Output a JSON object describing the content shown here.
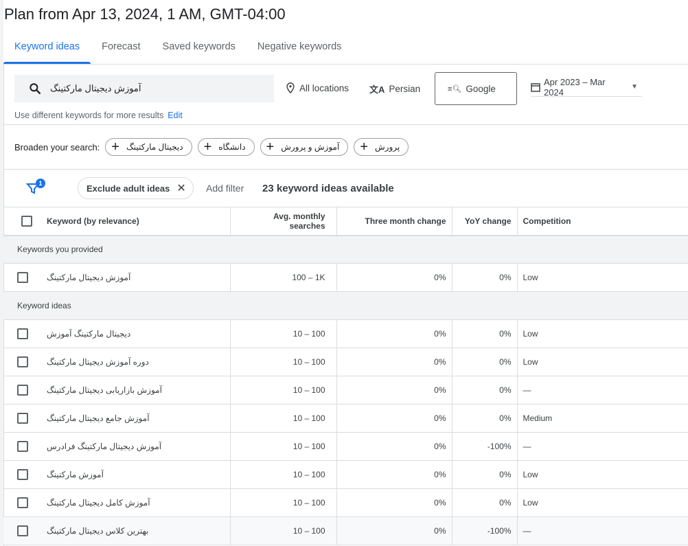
{
  "title": "Plan from Apr 13, 2024, 1 AM, GMT-04:00",
  "tabs": [
    {
      "label": "Keyword ideas"
    },
    {
      "label": "Forecast"
    },
    {
      "label": "Saved keywords"
    },
    {
      "label": "Negative keywords"
    }
  ],
  "search": {
    "value": "آموزش دیجیتال مارکتینگ",
    "location": "All locations",
    "language": "Persian",
    "network": "Google",
    "date_range": "Apr 2023 – Mar 2024",
    "hint": "Use different keywords for more results",
    "edit": "Edit"
  },
  "broaden": {
    "label": "Broaden your search:",
    "chips": [
      "دیجیتال مارکتینگ",
      "دانشگاه",
      "آموزش و پرورش",
      "پرورش"
    ]
  },
  "filters": {
    "badge": "1",
    "exclude": "Exclude adult ideas",
    "add_filter": "Add filter",
    "count": "23 keyword ideas available"
  },
  "table": {
    "headers": [
      "Keyword (by relevance)",
      "Avg. monthly searches",
      "Three month change",
      "YoY change",
      "Competition"
    ],
    "section_provided": "Keywords you provided",
    "provided": [
      {
        "kw": "آموزش دیجیتال مارکتینگ",
        "avg": "100 – 1K",
        "three": "0%",
        "yoy": "0%",
        "comp": "Low"
      }
    ],
    "section_ideas": "Keyword ideas",
    "ideas": [
      {
        "kw": "دیجیتال مارکتینگ آموزش",
        "avg": "10 – 100",
        "three": "0%",
        "yoy": "0%",
        "comp": "Low"
      },
      {
        "kw": "دوره آموزش دیجیتال مارکتینگ",
        "avg": "10 – 100",
        "three": "0%",
        "yoy": "0%",
        "comp": "Low"
      },
      {
        "kw": "آموزش بازاریابی دیجیتال مارکتینگ",
        "avg": "10 – 100",
        "three": "0%",
        "yoy": "0%",
        "comp": "—"
      },
      {
        "kw": "آموزش جامع دیجیتال مارکتینگ",
        "avg": "10 – 100",
        "three": "0%",
        "yoy": "0%",
        "comp": "Medium"
      },
      {
        "kw": "آموزش دیجیتال مارکتینگ فرادرس",
        "avg": "10 – 100",
        "three": "0%",
        "yoy": "-100%",
        "comp": "—"
      },
      {
        "kw": "آموزش مارکتینگ",
        "avg": "10 – 100",
        "three": "0%",
        "yoy": "0%",
        "comp": "Low"
      },
      {
        "kw": "آموزش کامل دیجیتال مارکتینگ",
        "avg": "10 – 100",
        "three": "0%",
        "yoy": "0%",
        "comp": "Low"
      },
      {
        "kw": "بهترین کلاس دیجیتال مارکتینگ",
        "avg": "10 – 100",
        "three": "0%",
        "yoy": "-100%",
        "comp": "—"
      }
    ]
  }
}
